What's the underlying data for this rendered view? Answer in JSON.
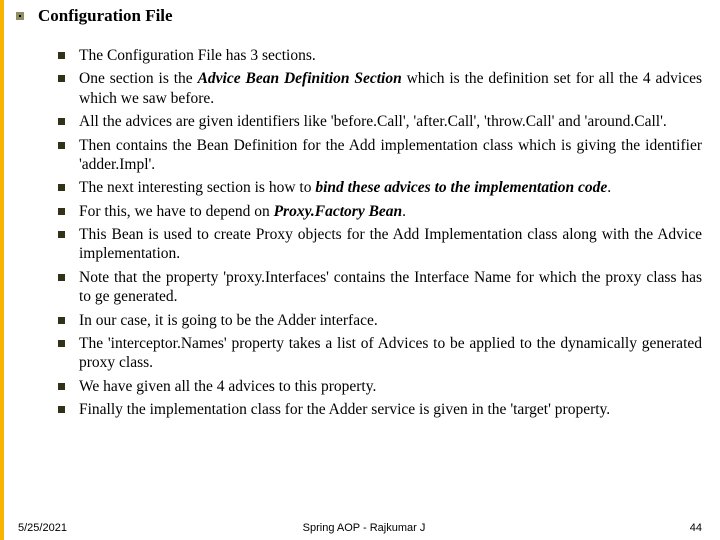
{
  "title": "Configuration File",
  "bullets": [
    {
      "pre": "The Configuration File has 3 sections."
    },
    {
      "pre": "One section is the ",
      "b1": "Advice Bean Definition Section",
      "mid1": " which is the definition set for all the 4 advices which we saw before."
    },
    {
      "pre": "All the advices are given identifiers like 'before.Call', 'after.Call', 'throw.Call' and 'around.Call'."
    },
    {
      "pre": "Then contains the Bean Definition for the Add implementation class which is giving the identifier 'adder.Impl'."
    },
    {
      "pre": "The next interesting section is how to ",
      "b1": "bind these advices to the implementation code",
      "mid1": "."
    },
    {
      "pre": "For this, we have to depend on ",
      "b1": "Proxy.Factory Bean",
      "mid1": "."
    },
    {
      "pre": "This Bean is used to create Proxy objects for the Add Implementation class along with the Advice implementation."
    },
    {
      "pre": "Note that the property 'proxy.Interfaces' contains the Interface Name for which the proxy class has to ge generated."
    },
    {
      "pre": "In our case, it is going to be the Adder interface."
    },
    {
      "pre": "The 'interceptor.Names' property takes a list of Advices to be applied to the dynamically generated proxy class."
    },
    {
      "pre": "We have given all the 4 advices to this property."
    },
    {
      "pre": "Finally the implementation class for the Adder service is given in the 'target' property."
    }
  ],
  "footer": {
    "date": "5/25/2021",
    "center": "Spring AOP  -  Rajkumar J",
    "page": "44"
  }
}
